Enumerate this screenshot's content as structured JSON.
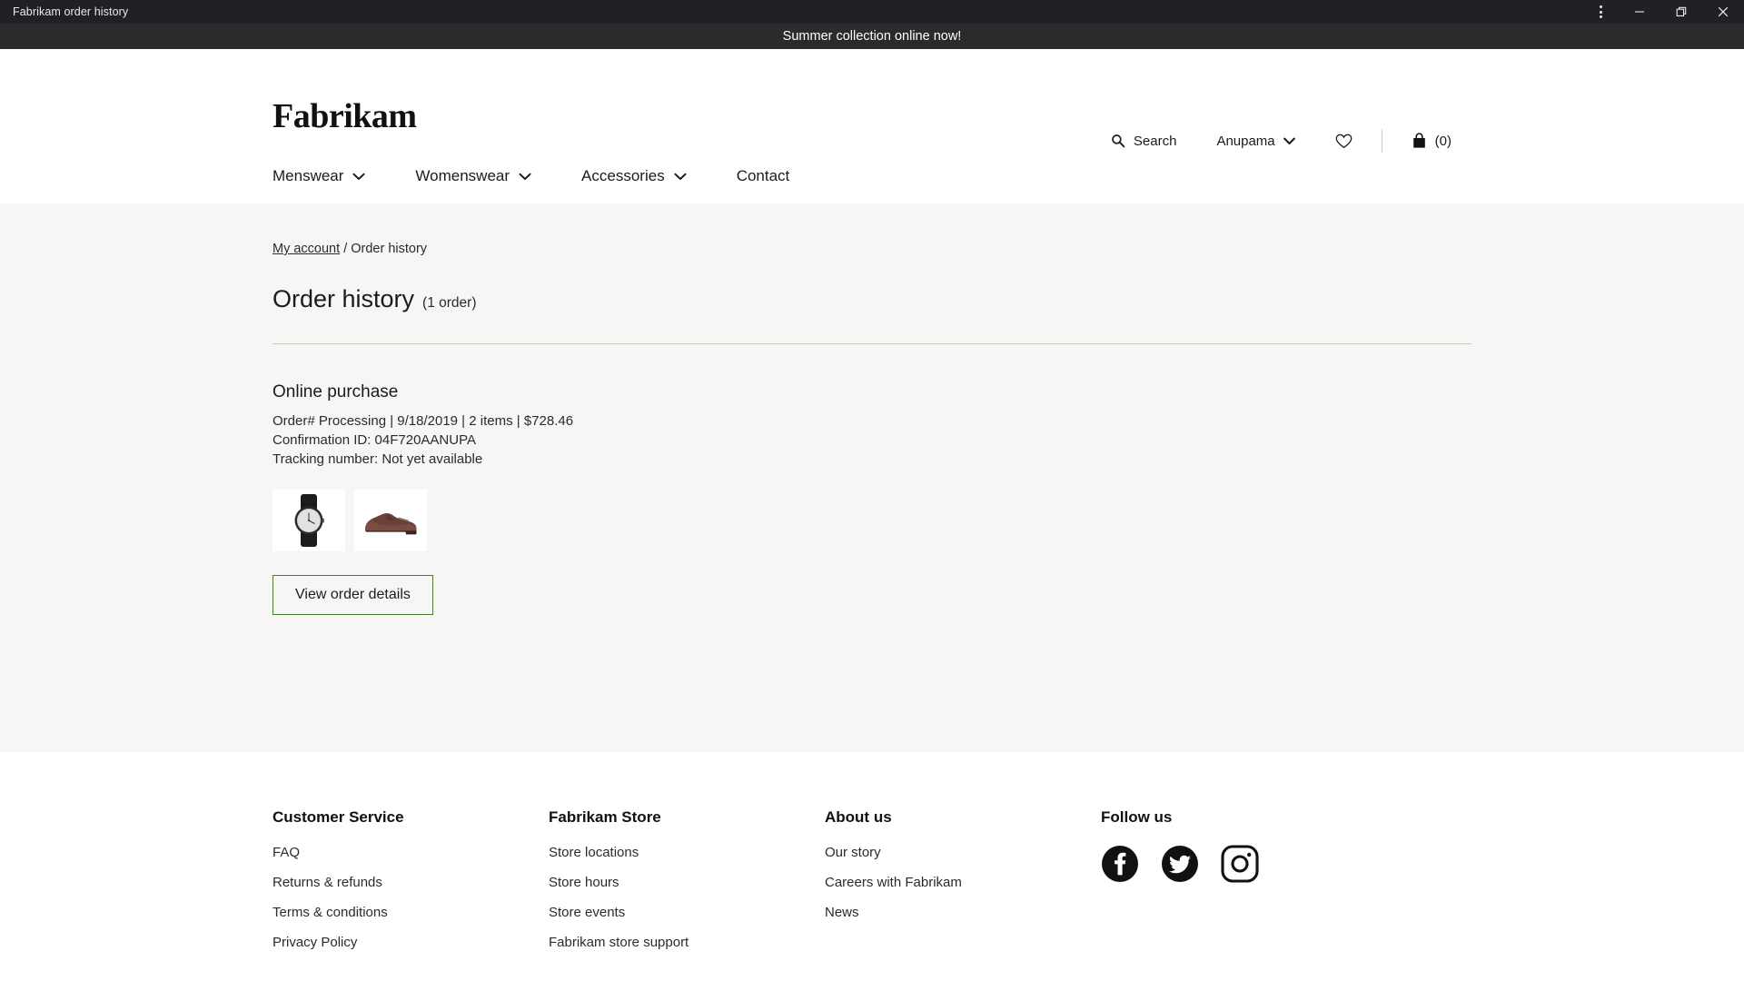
{
  "window": {
    "title": "Fabrikam order history",
    "controls": [
      {
        "name": "more-options",
        "icon": "kebab-icon"
      },
      {
        "name": "minimize",
        "icon": "minimize-icon"
      },
      {
        "name": "restore",
        "icon": "restore-icon"
      },
      {
        "name": "close",
        "icon": "close-icon"
      }
    ]
  },
  "promo": {
    "text": "Summer collection online now!",
    "background": "#2b2b2b",
    "color": "#ffffff"
  },
  "header": {
    "logo": "Fabrikam",
    "utils": {
      "search_label": "Search",
      "search_icon": "search-icon",
      "account_label": "Anupama",
      "account_chevron_icon": "chevron-down-icon",
      "wishlist_icon": "heart-icon",
      "cart_icon": "shopping-bag-icon",
      "cart_count": "(0)"
    }
  },
  "nav": {
    "items": [
      {
        "label": "Menswear",
        "has_chevron": true
      },
      {
        "label": "Womenswear",
        "has_chevron": true
      },
      {
        "label": "Accessories",
        "has_chevron": true
      },
      {
        "label": "Contact",
        "has_chevron": false
      }
    ]
  },
  "main": {
    "breadcrumb": {
      "link": "My account",
      "separator": "/",
      "current": "Order history"
    },
    "title": "Order history",
    "title_count": "(1 order)",
    "order": {
      "heading": "Online purchase",
      "summary": "Order# Processing | 9/18/2019 | 2 items | $728.46",
      "confirmation": "Confirmation ID: 04F720AANUPA",
      "tracking": "Tracking number: Not yet available",
      "thumbnails": [
        {
          "name": "product-thumbnail-watch",
          "alt": "watch"
        },
        {
          "name": "product-thumbnail-shoe",
          "alt": "brown dress shoe"
        }
      ],
      "details_button": "View order details",
      "details_button_border": "#4a7c35"
    }
  },
  "footer": {
    "columns": [
      {
        "title": "Customer Service",
        "links": [
          "FAQ",
          "Returns & refunds",
          "Terms & conditions",
          "Privacy Policy"
        ]
      },
      {
        "title": "Fabrikam Store",
        "links": [
          "Store locations",
          "Store hours",
          "Store events",
          "Fabrikam store support"
        ]
      },
      {
        "title": "About us",
        "links": [
          "Our story",
          "Careers with Fabrikam",
          "News"
        ]
      }
    ],
    "follow": {
      "title": "Follow us",
      "socials": [
        {
          "name": "facebook-icon",
          "label": "Facebook"
        },
        {
          "name": "twitter-icon",
          "label": "Twitter"
        },
        {
          "name": "instagram-icon",
          "label": "Instagram"
        }
      ]
    }
  }
}
